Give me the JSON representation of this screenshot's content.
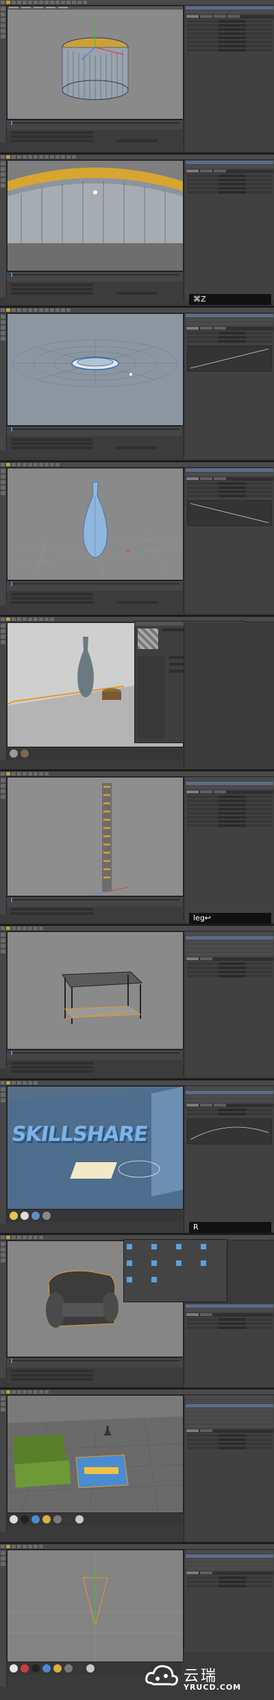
{
  "panels": [
    {
      "id": "p1",
      "title": "modeling-cylinder"
    },
    {
      "id": "p2",
      "title": "cylinder-closeup"
    },
    {
      "id": "p3",
      "title": "lathe-profile"
    },
    {
      "id": "p4",
      "title": "vase"
    },
    {
      "id": "p5",
      "title": "material-editor"
    },
    {
      "id": "p6",
      "title": "array-column"
    },
    {
      "id": "p7",
      "title": "table"
    },
    {
      "id": "p8",
      "title": "skillshare-text"
    },
    {
      "id": "p9",
      "title": "armchair"
    },
    {
      "id": "p10",
      "title": "scene"
    },
    {
      "id": "p11",
      "title": "cone"
    }
  ],
  "keycaps": {
    "k1": "⌘Z",
    "k2": "leg↩",
    "k3": "R"
  },
  "viewport_text": {
    "skillshare": "SKILLSHARE"
  },
  "watermark": {
    "brand_cn": "云瑞",
    "brand_url": "YRUCD.COM"
  },
  "colors": {
    "ui_bg": "#3a3a3a",
    "viewport_bg": "#7a7a7a",
    "selection_orange": "#e39a2a",
    "object_blue": "#6fa6d8",
    "accent_blue": "#4b8fd6"
  }
}
